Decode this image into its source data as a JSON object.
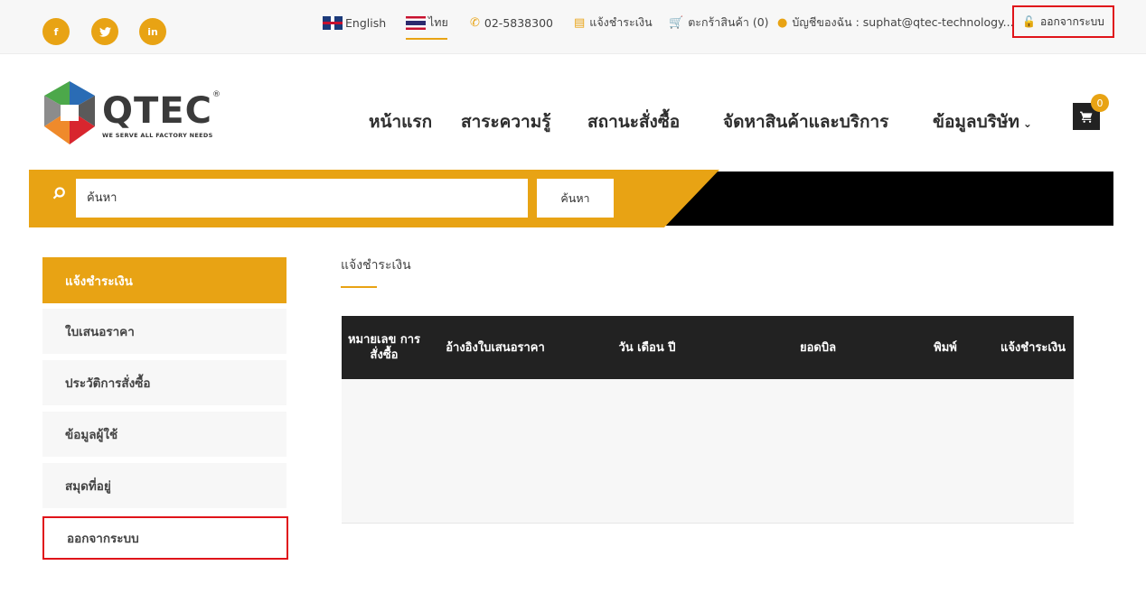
{
  "topbar": {
    "social": [
      {
        "label": "f",
        "icon": "facebook-icon"
      },
      {
        "label": "t",
        "icon": "twitter-icon"
      },
      {
        "label": "in",
        "icon": "linkedin-icon"
      }
    ],
    "lang_en": "English",
    "lang_th": "ไทย",
    "phone": "02-5838300",
    "payment": "แจ้งชำระเงิน",
    "cart": "ตะกร้าสินค้า (0)",
    "account": "บัญชีของฉัน : suphat@qtec-technology...",
    "logout": "ออกจากระบบ"
  },
  "logo": {
    "name": "QTEC",
    "reg": "®",
    "tagline": "WE SERVE ALL FACTORY NEEDS"
  },
  "nav": {
    "home": "หน้าแรก",
    "knowledge": "สาระความรู้",
    "order_status": "สถานะสั่งซื้อ",
    "procurement": "จัดหาสินค้าและบริการ",
    "company": "ข้อมูลบริษัท"
  },
  "cart_count": "0",
  "search": {
    "placeholder": "ค้นหา",
    "button": "ค้นหา"
  },
  "sidebar": {
    "items": [
      {
        "label": "แจ้งชำระเงิน",
        "active": true
      },
      {
        "label": "ใบเสนอราคา"
      },
      {
        "label": "ประวัติการสั่งซื้อ"
      },
      {
        "label": "ข้อมูลผู้ใช้"
      },
      {
        "label": "สมุดที่อยู่"
      },
      {
        "label": "ออกจากระบบ"
      }
    ]
  },
  "main": {
    "title": "แจ้งชำระเงิน",
    "table_headers": [
      "หมายเลข การ สั่งซื้อ",
      "อ้างอิงใบเสนอราคา",
      "วัน เดือน ปี",
      "ยอดบิล",
      "พิมพ์",
      "แจ้งชำระเงิน"
    ],
    "rows": []
  },
  "colors": {
    "accent": "#e8a314",
    "dark": "#222222",
    "highlight": "#e0141a"
  }
}
